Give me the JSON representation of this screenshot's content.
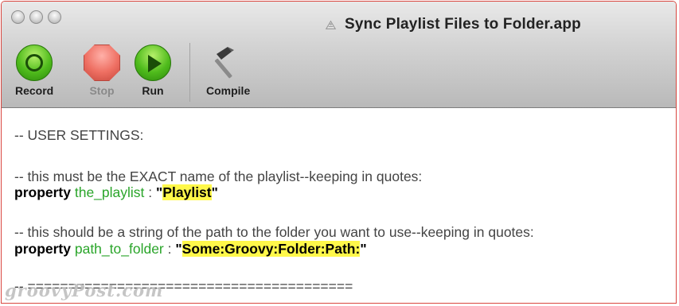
{
  "window": {
    "title": "Sync Playlist Files to Folder.app"
  },
  "toolbar": {
    "record_label": "Record",
    "stop_label": "Stop",
    "run_label": "Run",
    "compile_label": "Compile"
  },
  "editor": {
    "line1": "-- USER SETTINGS:",
    "line2": "-- this must be the EXACT name of the playlist--keeping in quotes:",
    "line3": {
      "keyword": "property",
      "variable": "the_playlist",
      "separator": " : ",
      "open_quote": "\"",
      "value": "Playlist",
      "close_quote": "\""
    },
    "line4": "-- this should be a string of the path to the folder you want to use--keeping in quotes:",
    "line5": {
      "keyword": "property",
      "variable": "path_to_folder",
      "separator": " : ",
      "open_quote": "\"",
      "value": "Some:Groovy:Folder:Path:",
      "close_quote": "\""
    },
    "line6": "-- ========================================"
  },
  "watermark": "groovyPost.com",
  "colors": {
    "keyword": "#000000",
    "variable": "#2aa52a",
    "highlight": "#fff84a",
    "window_border": "#d9463f"
  },
  "icons": {
    "title": "applescript-icon",
    "record": "record-icon",
    "stop": "stop-icon",
    "run": "run-icon",
    "compile": "hammer-icon"
  }
}
